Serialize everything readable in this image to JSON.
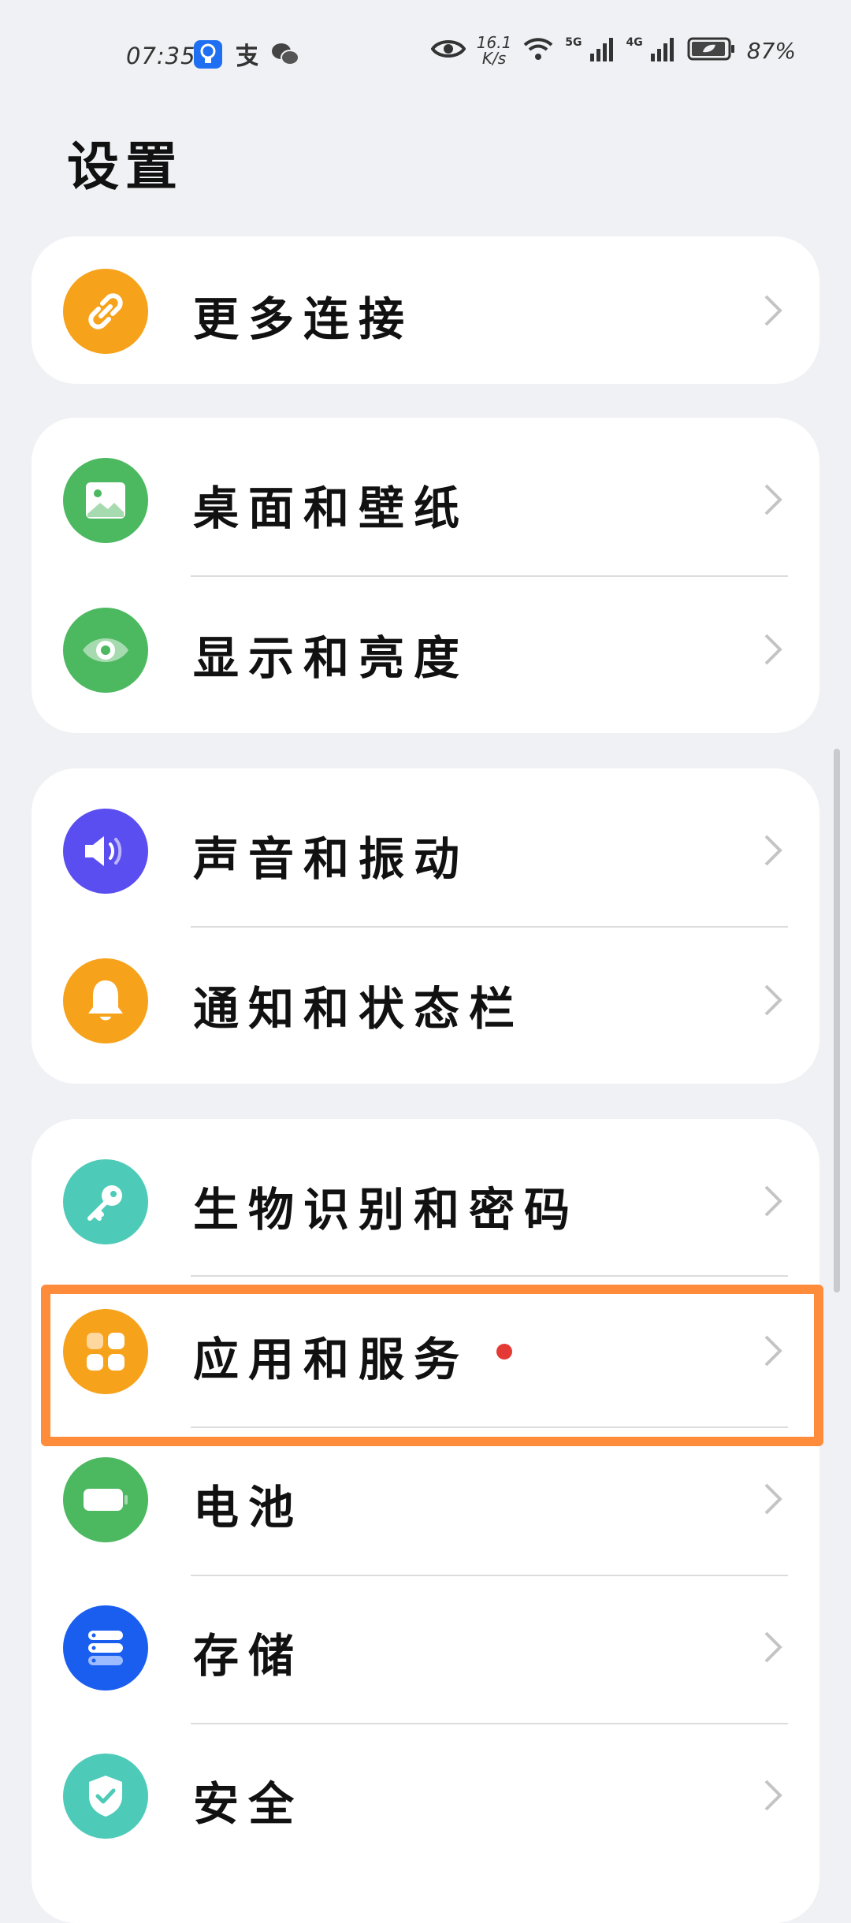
{
  "status_bar": {
    "time": "07:35",
    "net_speed_value": "16.1",
    "net_speed_unit": "K/s",
    "signal1_label": "5G",
    "signal2_label": "4G",
    "battery_percent": "87%"
  },
  "page": {
    "title": "设置"
  },
  "cards": [
    {
      "items": [
        {
          "label": "更多连接",
          "icon": "link-icon",
          "color": "#f7a21b"
        }
      ]
    },
    {
      "items": [
        {
          "label": "桌面和壁纸",
          "icon": "wallpaper-icon",
          "color": "#4cb860"
        },
        {
          "label": "显示和亮度",
          "icon": "eye-icon",
          "color": "#4cb860"
        }
      ]
    },
    {
      "items": [
        {
          "label": "声音和振动",
          "icon": "speaker-icon",
          "color": "#5b4ef0"
        },
        {
          "label": "通知和状态栏",
          "icon": "bell-icon",
          "color": "#f7a21b"
        }
      ]
    },
    {
      "items": [
        {
          "label": "生物识别和密码",
          "icon": "key-icon",
          "color": "#4ecbb8"
        },
        {
          "label": "应用和服务",
          "icon": "apps-icon",
          "color": "#f7a21b",
          "badge": "red-dot"
        },
        {
          "label": "电池",
          "icon": "battery-icon",
          "color": "#4cb860"
        },
        {
          "label": "存储",
          "icon": "storage-icon",
          "color": "#1a5ef0"
        },
        {
          "label": "安全",
          "icon": "shield-icon",
          "color": "#4ecbb8"
        }
      ]
    }
  ],
  "colors": {
    "highlight": "#ff8c3a",
    "background": "#f0f1f4"
  }
}
